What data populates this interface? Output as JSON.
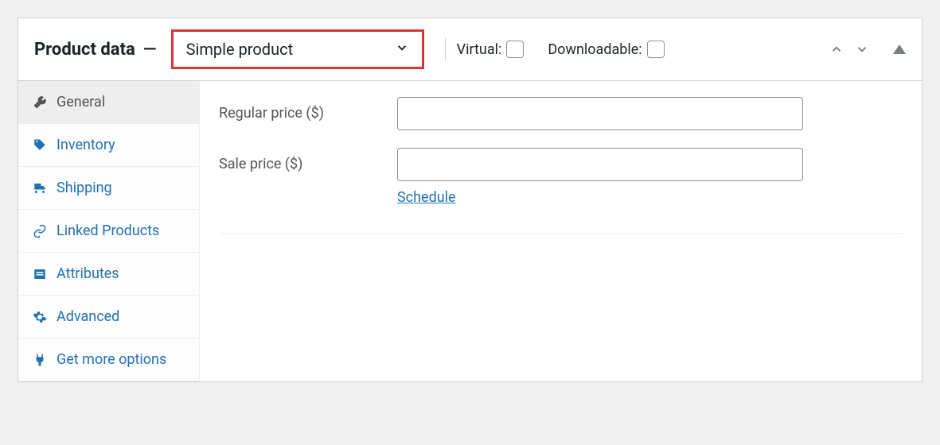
{
  "header": {
    "title": "Product data",
    "product_type": "Simple product",
    "virtual_label": "Virtual:",
    "downloadable_label": "Downloadable:",
    "virtual_checked": false,
    "downloadable_checked": false,
    "highlight_color": "#d63638",
    "link_color": "#2271b1"
  },
  "sidebar": {
    "items": [
      {
        "icon": "wrench-icon",
        "label": "General",
        "active": true
      },
      {
        "icon": "tag-icon",
        "label": "Inventory",
        "active": false
      },
      {
        "icon": "truck-icon",
        "label": "Shipping",
        "active": false
      },
      {
        "icon": "link-icon",
        "label": "Linked Products",
        "active": false
      },
      {
        "icon": "list-icon",
        "label": "Attributes",
        "active": false
      },
      {
        "icon": "gear-icon",
        "label": "Advanced",
        "active": false
      },
      {
        "icon": "plug-icon",
        "label": "Get more options",
        "active": false
      }
    ]
  },
  "content": {
    "regular_price_label": "Regular price ($)",
    "regular_price_value": "",
    "sale_price_label": "Sale price ($)",
    "sale_price_value": "",
    "schedule_link": "Schedule"
  }
}
